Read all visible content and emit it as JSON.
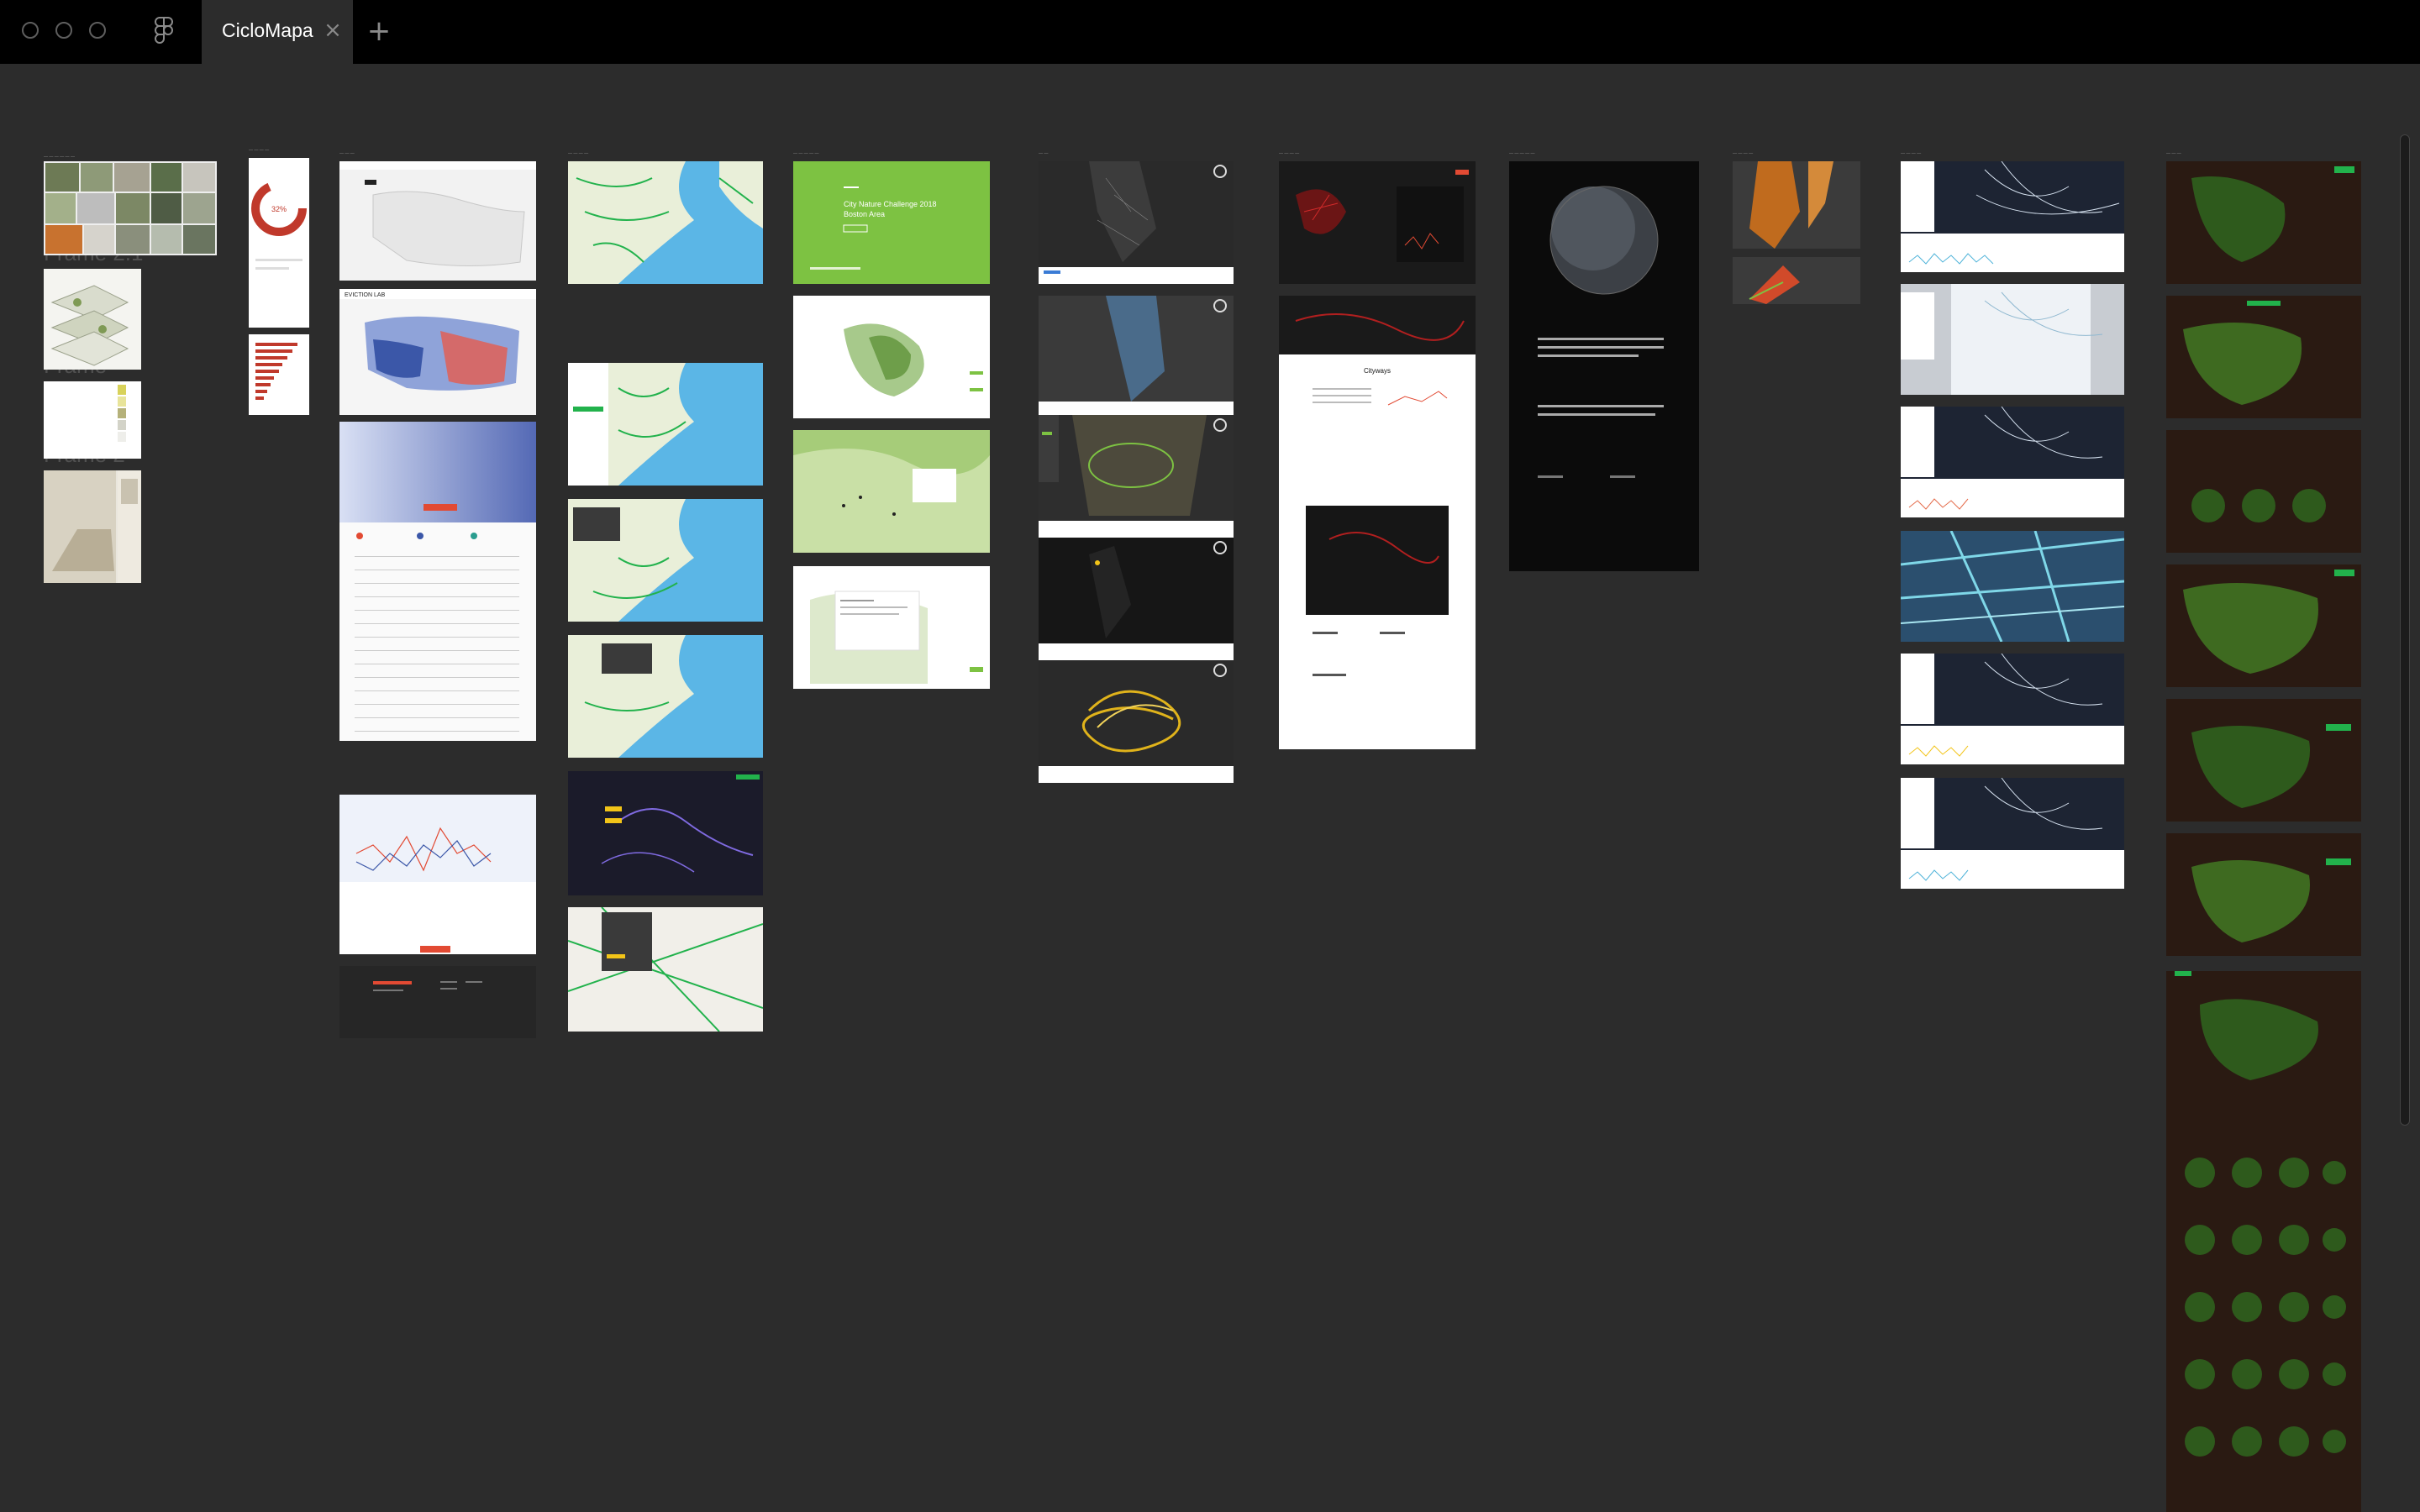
{
  "window": {
    "tab_title": "CicloMapa",
    "close_glyph": "×",
    "new_tab_glyph": "+"
  },
  "canvas": {
    "ghost_labels": [
      "Frame 2.1",
      "Frame",
      "Frame 2"
    ],
    "frame_groups": [
      "moodboard",
      "circular-chart",
      "eviction-lab",
      "bike-map",
      "city-nature-challenge",
      "nyc-map",
      "cityways",
      "globe",
      "orange-map",
      "flow-map",
      "green-dark-map"
    ],
    "samples": {
      "nature_title": "City Nature Challenge 2018 Boston Area",
      "eviction_logo": "EVICTION LAB",
      "cityways_title": "Cityways"
    }
  },
  "colors": {
    "titlebar": "#000000",
    "canvas": "#2c2c2c",
    "accent_red": "#e24a33",
    "nature_green": "#7dc242",
    "map_water": "#5bb6e6"
  },
  "icons": [
    "figma-logo-icon",
    "close-icon",
    "plus-icon"
  ]
}
